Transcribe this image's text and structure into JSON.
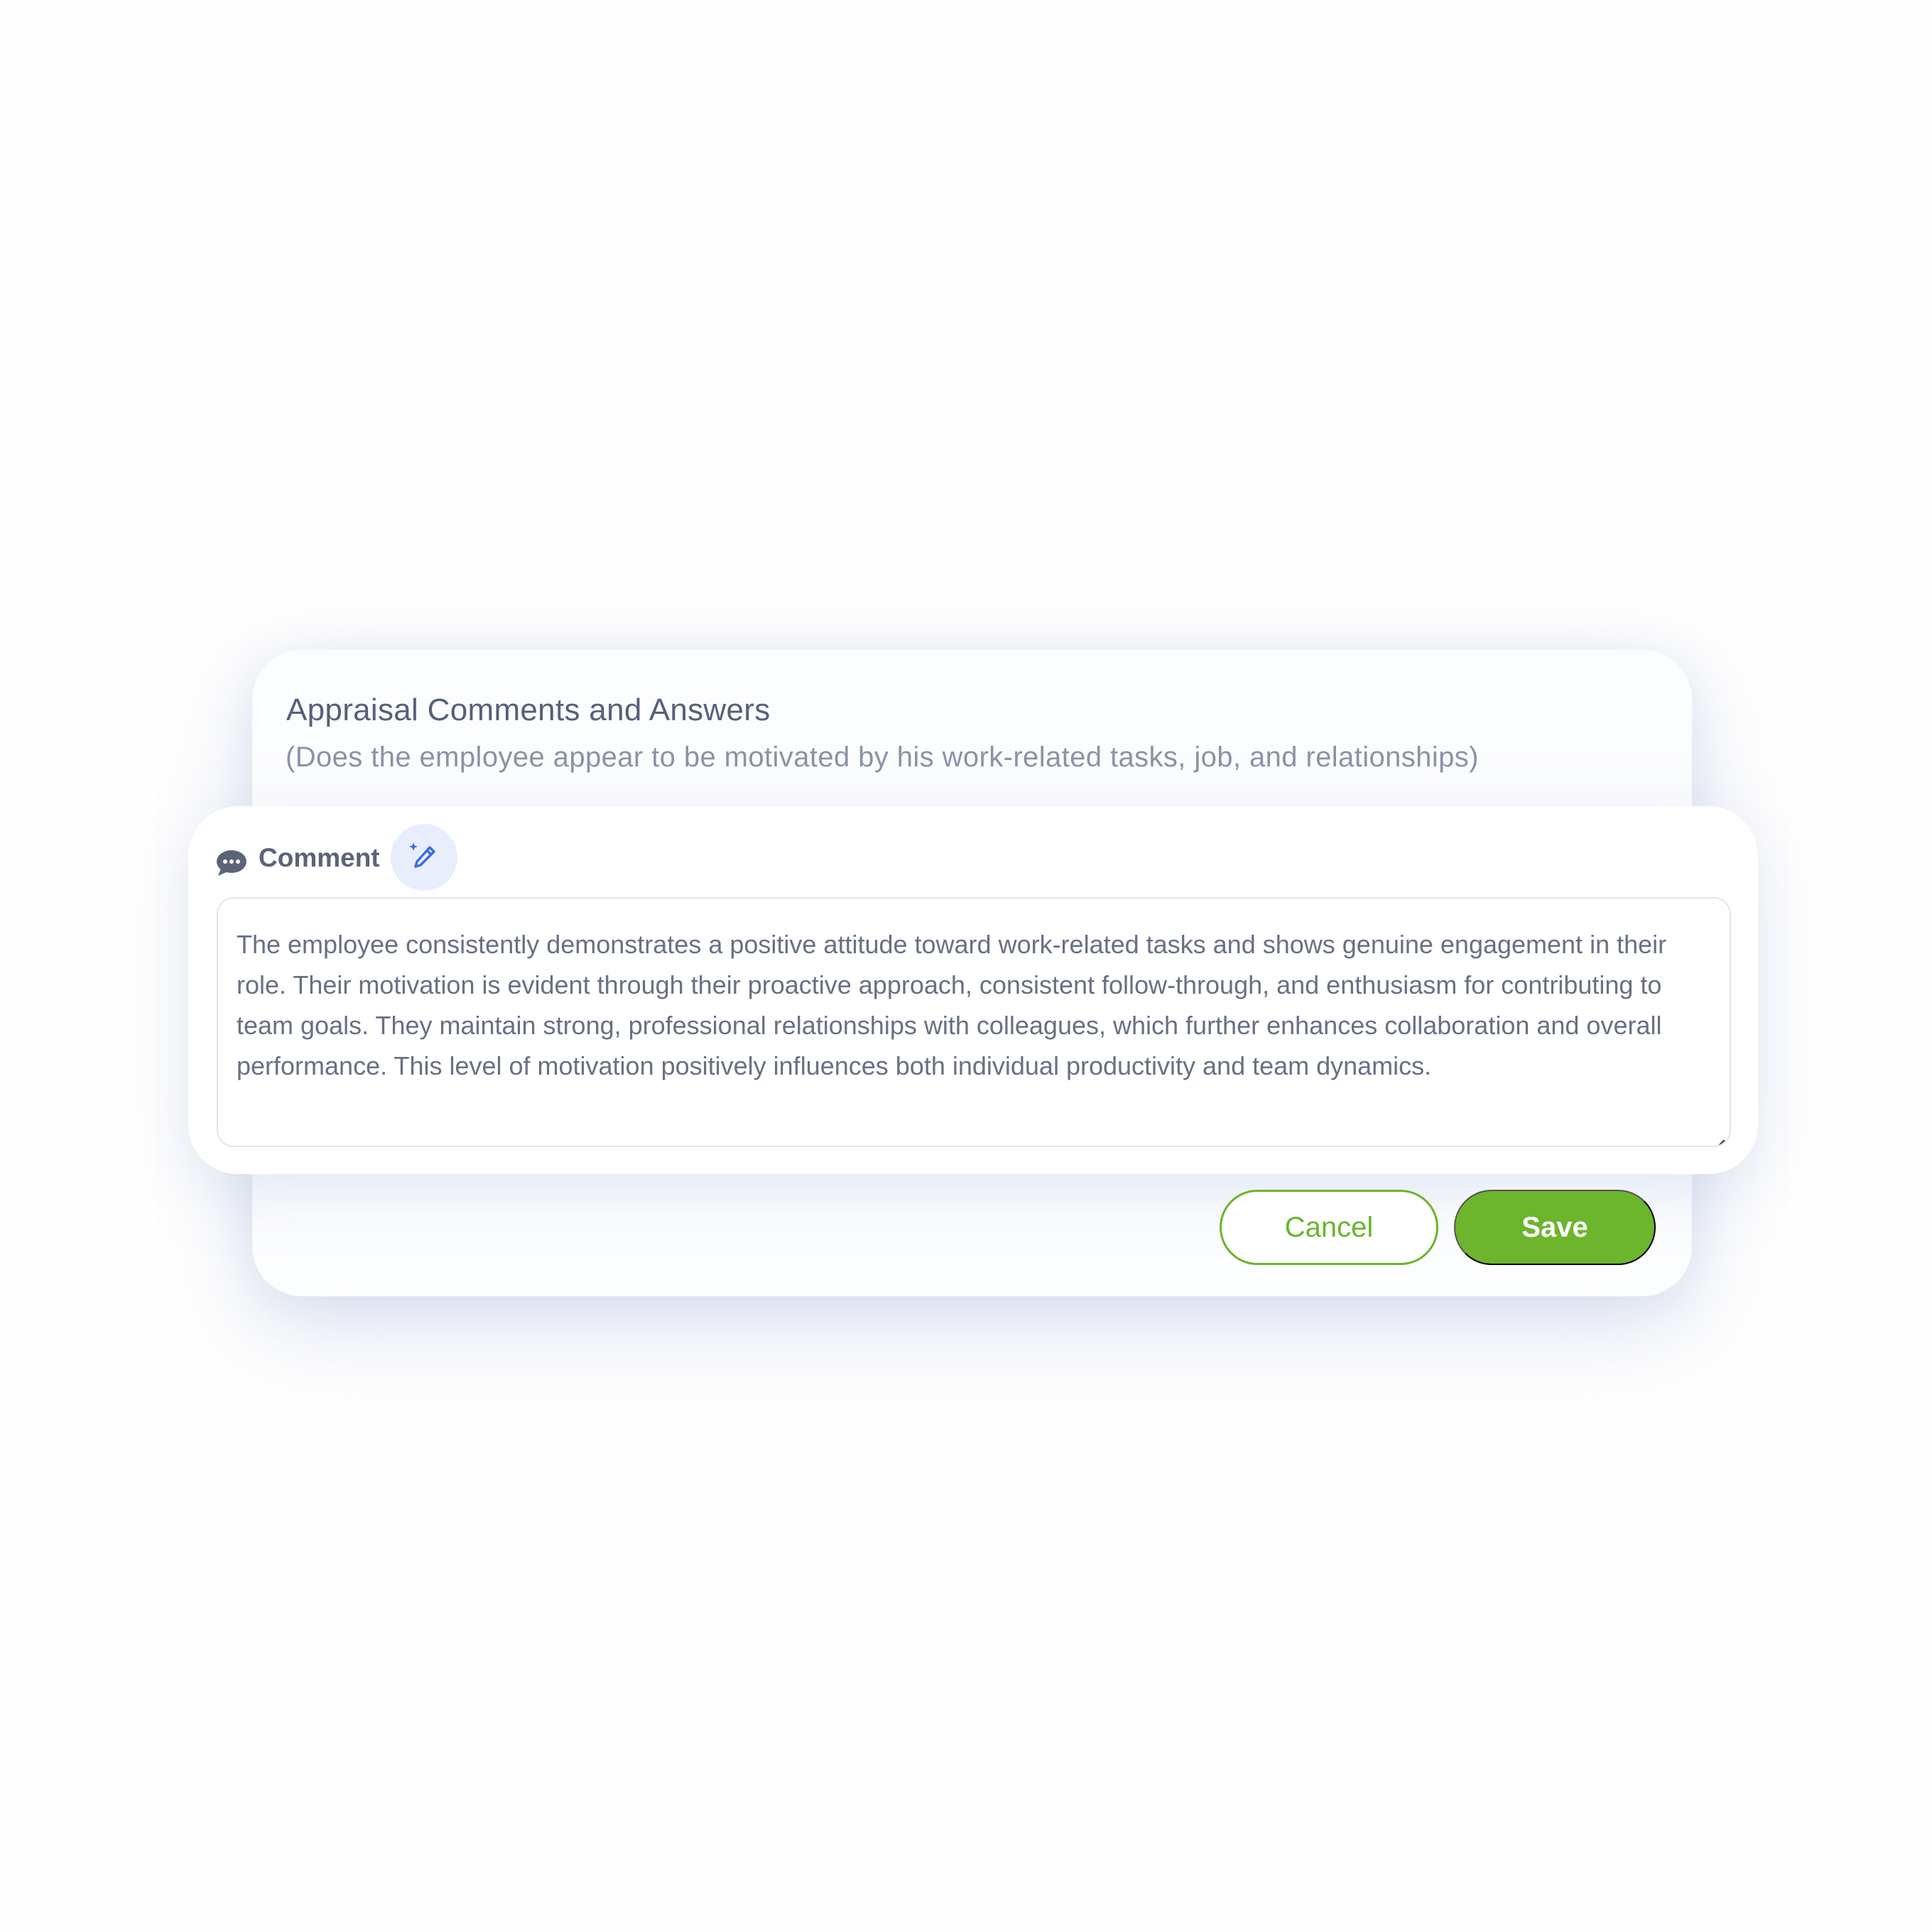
{
  "section": {
    "title": "Appraisal Comments and Answers",
    "question": "(Does the employee appear to be motivated by his work-related tasks, job, and relationships)"
  },
  "comment": {
    "label": "Comment",
    "icon": "chat-bubble-icon",
    "ai_icon": "magic-pen-icon",
    "text": "The employee consistently demonstrates a positive attitude toward work-related tasks and shows genuine engagement in their role. Their motivation is evident through their proactive approach, consistent follow-through, and enthusiasm for contributing to team goals. They maintain strong, professional relationships with colleagues, which further enhances collaboration and overall performance. This level of motivation positively influences both individual productivity and team dynamics."
  },
  "actions": {
    "cancel_label": "Cancel",
    "save_label": "Save"
  },
  "colors": {
    "accent_green": "#6db52d",
    "ai_blue": "#3b6fd8",
    "text_gray": "#5b6477"
  }
}
